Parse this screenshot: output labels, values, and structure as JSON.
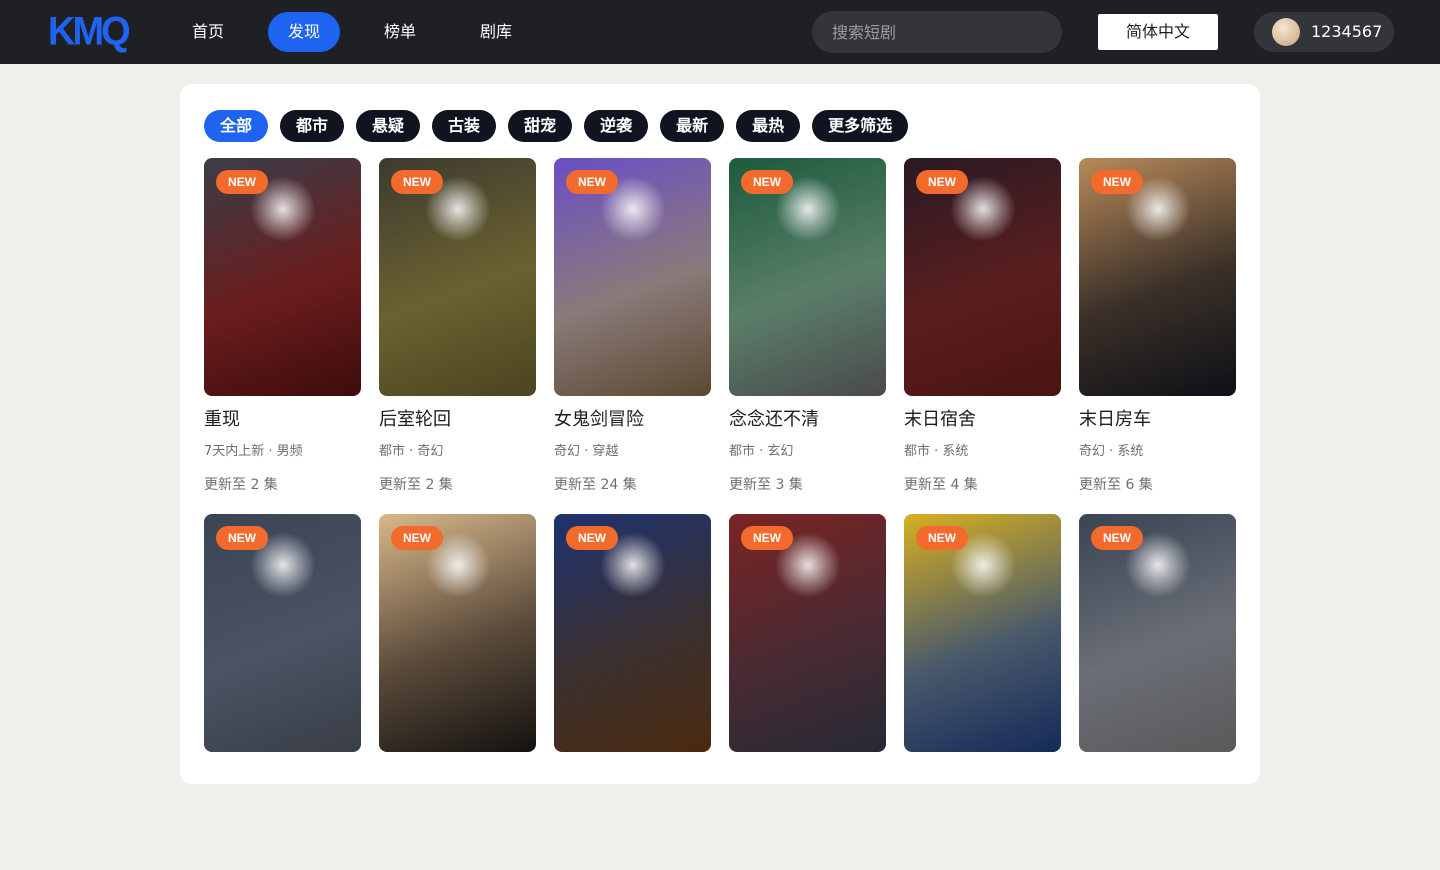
{
  "header": {
    "logo": "KMQ",
    "nav": [
      "首页",
      "发现",
      "榜单",
      "剧库"
    ],
    "active_nav": "发现",
    "search_placeholder": "搜索短剧",
    "language_button": "简体中文",
    "user_name": "1234567"
  },
  "filters": {
    "chips": [
      "全部",
      "都市",
      "悬疑",
      "古装",
      "甜宠",
      "逆袭",
      "最新",
      "最热",
      "更多筛选"
    ],
    "active": "全部"
  },
  "dramas": [
    {
      "badge": "NEW",
      "title": "重现",
      "meta": "7天内上新 · 男频",
      "episodes": "更新至 2 集",
      "colors": [
        "#3a3d48",
        "#6b1d1d",
        "#3d0c0c"
      ]
    },
    {
      "badge": "NEW",
      "title": "后室轮回",
      "meta": "都市 · 奇幻",
      "episodes": "更新至 2 集",
      "colors": [
        "#3d3a30",
        "#6b6230",
        "#4a4420"
      ]
    },
    {
      "badge": "NEW",
      "title": "女鬼剑冒险",
      "meta": "奇幻 · 穿越",
      "episodes": "更新至 24 集",
      "colors": [
        "#6a4ec6",
        "#8a7a7a",
        "#5a4a30"
      ]
    },
    {
      "badge": "NEW",
      "title": "念念还不清",
      "meta": "都市 · 玄幻",
      "episodes": "更新至 3 集",
      "colors": [
        "#1c5a3e",
        "#5a7e6a",
        "#4a4a4a"
      ]
    },
    {
      "badge": "NEW",
      "title": "末日宿舍",
      "meta": "都市 · 系统",
      "episodes": "更新至 4 集",
      "colors": [
        "#2a1a24",
        "#5a1e1e",
        "#4a1410"
      ]
    },
    {
      "badge": "NEW",
      "title": "末日房车",
      "meta": "奇幻 · 系统",
      "episodes": "更新至 6 集",
      "colors": [
        "#b88a5a",
        "#3a3028",
        "#0e1016"
      ]
    },
    {
      "badge": "NEW",
      "title": "",
      "meta": "",
      "episodes": "",
      "colors": [
        "#3a4454",
        "#4a5464",
        "#3a3e46"
      ]
    },
    {
      "badge": "NEW",
      "title": "",
      "meta": "",
      "episodes": "",
      "colors": [
        "#d8b88a",
        "#5a4a3a",
        "#141210"
      ]
    },
    {
      "badge": "NEW",
      "title": "",
      "meta": "",
      "episodes": "",
      "colors": [
        "#1e3270",
        "#3a3030",
        "#4a2a0e"
      ]
    },
    {
      "badge": "NEW",
      "title": "",
      "meta": "",
      "episodes": "",
      "colors": [
        "#7a2424",
        "#4a2a32",
        "#262a34"
      ]
    },
    {
      "badge": "NEW",
      "title": "",
      "meta": "",
      "episodes": "",
      "colors": [
        "#d8b020",
        "#4a5a6a",
        "#142a5a"
      ]
    },
    {
      "badge": "NEW",
      "title": "",
      "meta": "",
      "episodes": "",
      "colors": [
        "#3a4454",
        "#6a6e76",
        "#5a5a5a"
      ]
    }
  ],
  "colors": {
    "topbar": "#1f2024",
    "accent": "#1e64f0",
    "badge": "#f26a2c",
    "chip": "#0f1420",
    "page_bg": "#f0efeb"
  }
}
